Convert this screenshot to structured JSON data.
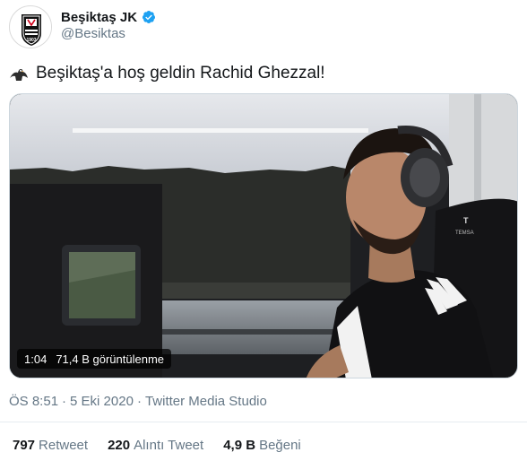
{
  "account": {
    "display_name": "Beşiktaş JK",
    "handle": "@Besiktas",
    "verified": true,
    "logo_year": "1903"
  },
  "tweet": {
    "text": "Beşiktaş'a hoş geldin Rachid Ghezzal!",
    "emoji_icon": "eagle-icon"
  },
  "video": {
    "duration": "1:04",
    "views": "71,4 B görüntülenme"
  },
  "meta": {
    "time": "ÖS 8:51",
    "separator": "·",
    "date": "5 Eki 2020",
    "source": "Twitter Media Studio"
  },
  "stats": {
    "retweets_count": "797",
    "retweets_label": "Retweet",
    "quotes_count": "220",
    "quotes_label": "Alıntı Tweet",
    "likes_count": "4,9 B",
    "likes_label": "Beğeni"
  },
  "colors": {
    "verified_blue": "#1da1f2",
    "secondary_text": "#657786",
    "primary_text": "#14171a"
  }
}
